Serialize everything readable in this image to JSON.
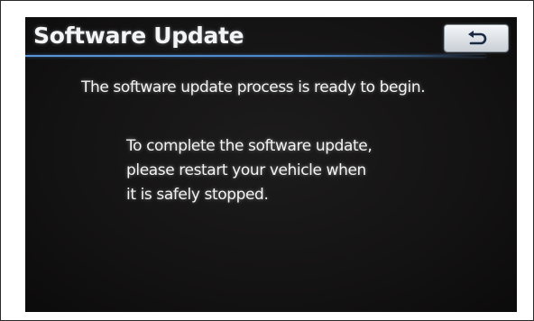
{
  "screen": {
    "title": "Software Update",
    "back_button": {
      "icon": "return-arrow-icon"
    },
    "message_main": "The software update process is ready to begin.",
    "instruction_lines": [
      "To complete the software update,",
      "please restart your vehicle when",
      "it is safely stopped."
    ]
  },
  "colors": {
    "background": "#141313",
    "text": "#f4f4f4",
    "accent_underline": "#4a86cc",
    "button_face": "#e1e5e9"
  }
}
